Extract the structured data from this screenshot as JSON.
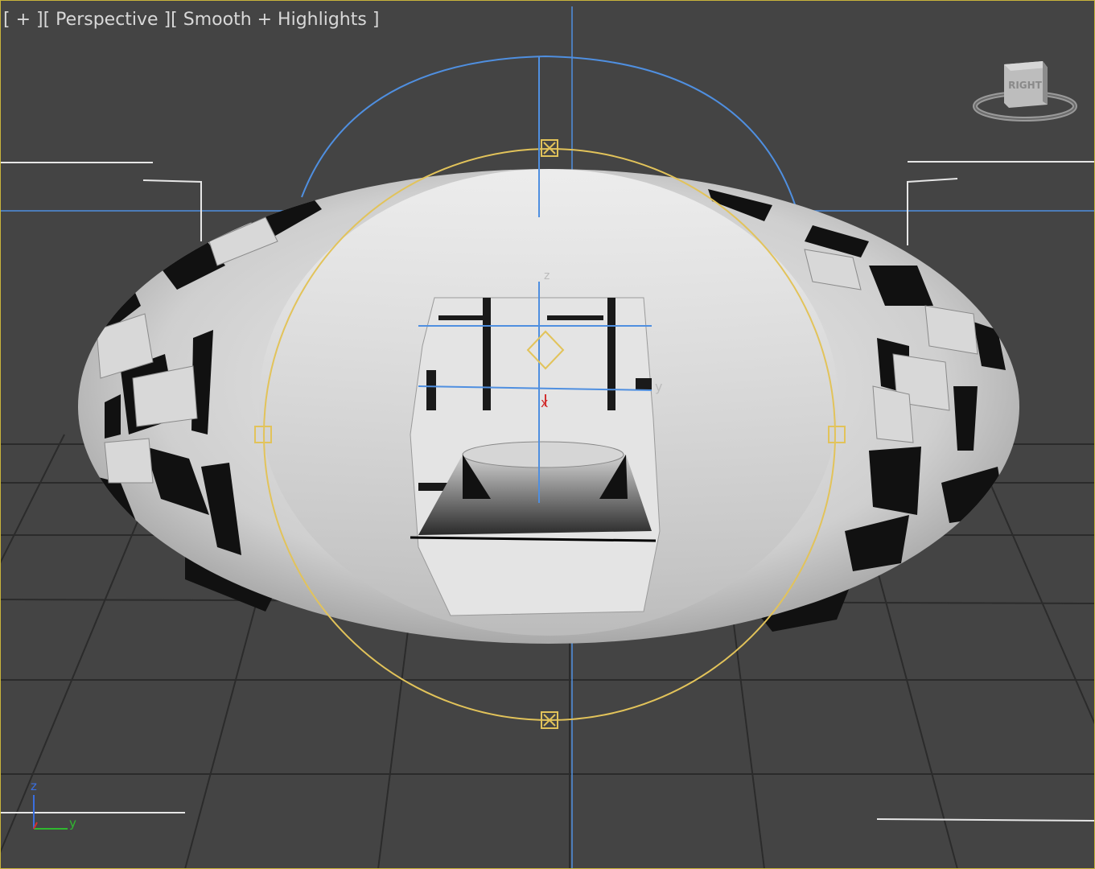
{
  "viewport": {
    "label_parts": [
      "[ + ]",
      "[ Perspective ]",
      "[ Smooth + Highlights ]"
    ],
    "viewcube_face": "RIGHT",
    "axis_tripod": {
      "z": "z",
      "y": "y"
    },
    "gizmo_axes": {
      "z": "z",
      "x": "x",
      "y": "y"
    }
  },
  "colors": {
    "background": "#444444",
    "grid": "#2b2b2b",
    "selection_gizmo": "#e2c35a",
    "rotate_gizmo": "#4f8fe0",
    "axis_x": "#d23030",
    "axis_y": "#2fb82f",
    "axis_z": "#3a6fe0",
    "active_border": "#c8b43c"
  }
}
